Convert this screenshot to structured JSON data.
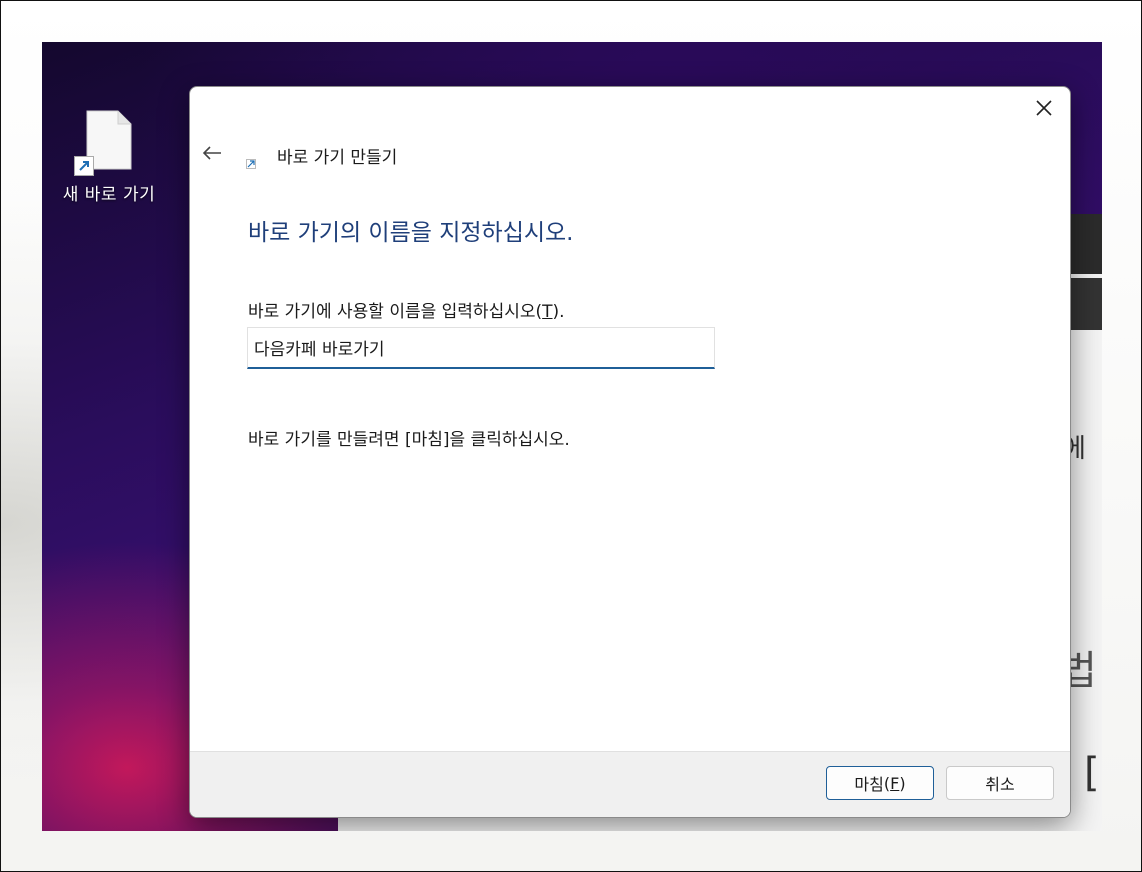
{
  "desktop": {
    "shortcut_icon": {
      "label": "새 바로 가기",
      "icon": "file-shortcut-icon"
    },
    "bg_fragments": {
      "right_a": "에",
      "right_b": "법",
      "right_c": "["
    }
  },
  "dialog": {
    "wizard_title": "바로 가기 만들기",
    "heading": "바로 가기의 이름을 지정하십시오.",
    "name_prompt": {
      "text": "바로 가기에 사용할 이름을 입력하십시오",
      "mnemonic": "T",
      "open": "(",
      "close": ").",
      "underlined": "T"
    },
    "name_input": {
      "value": "다음카페 바로가기"
    },
    "instruction": "바로 가기를 만들려면 [마침]을 클릭하십시오.",
    "buttons": {
      "finish": {
        "label": "마침",
        "open": "(",
        "mnemonic": "F",
        "close": ")"
      },
      "cancel": {
        "label": "취소"
      }
    },
    "icons": {
      "back": "back-arrow-icon",
      "close": "close-icon",
      "wizard": "shortcut-wizard-icon"
    }
  },
  "colors": {
    "heading": "#1f3f7a",
    "input_underline": "#1f5f98",
    "footer_bg": "#f0f0f0"
  }
}
